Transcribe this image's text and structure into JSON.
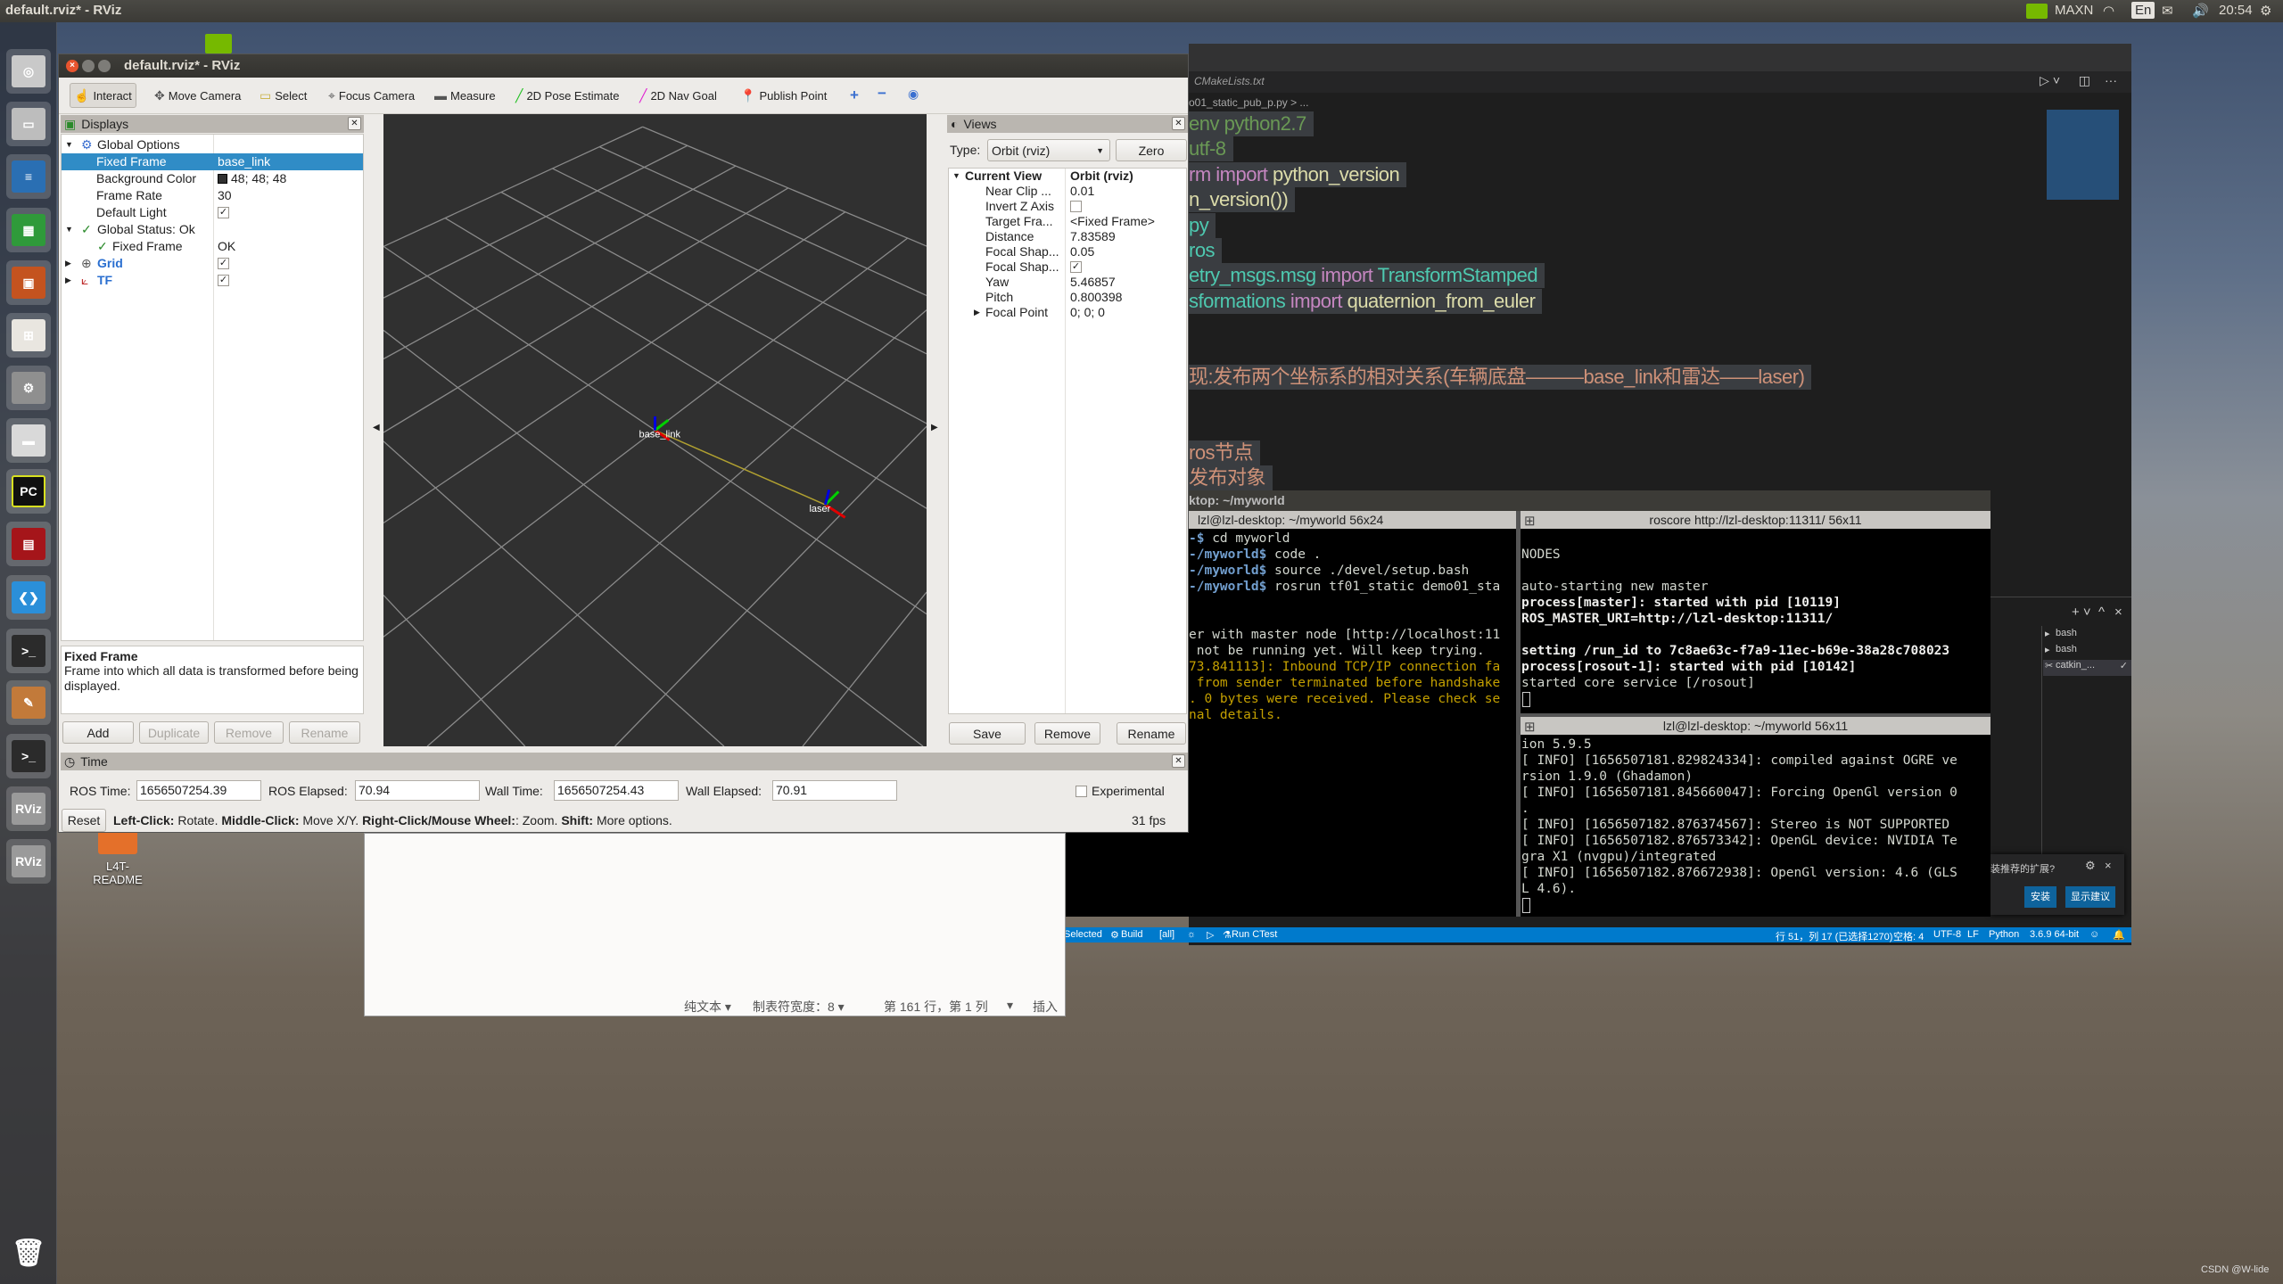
{
  "topbar": {
    "title": "default.rviz* - RViz",
    "power_mode": "MAXN",
    "input_method": "En",
    "clock": "20:54",
    "icons": [
      "nvidia-icon",
      "wifi-icon",
      "keyboard-icon",
      "mail-icon",
      "volume-icon",
      "settings-gear-icon"
    ]
  },
  "launcher": {
    "items": [
      {
        "name": "ubuntu-dash",
        "glyph": "◎",
        "color": "#c9c9c9"
      },
      {
        "name": "files",
        "glyph": "▭",
        "color": "#bdbdbd"
      },
      {
        "name": "libreoffice-writer",
        "glyph": "≡",
        "color": "#2a6fb3"
      },
      {
        "name": "libreoffice-calc",
        "glyph": "▦",
        "color": "#2f9a3a"
      },
      {
        "name": "libreoffice-impress",
        "glyph": "▣",
        "color": "#c4531f"
      },
      {
        "name": "software-center",
        "glyph": "⊞",
        "color": "#e9e6e0"
      },
      {
        "name": "system-settings",
        "glyph": "⚙",
        "color": "#8f8f8f"
      },
      {
        "name": "disks",
        "glyph": "▬",
        "color": "#d9d9d9"
      },
      {
        "name": "pycharm",
        "glyph": "PC",
        "color": "#101010"
      },
      {
        "name": "app-red",
        "glyph": "▤",
        "color": "#a5151a"
      },
      {
        "name": "vscode",
        "glyph": "❮❯",
        "color": "#2b8fd9"
      },
      {
        "name": "terminal",
        "glyph": ">_",
        "color": "#2b2b2b"
      },
      {
        "name": "text-editor",
        "glyph": "✎",
        "color": "#c27a3a"
      },
      {
        "name": "terminal",
        "glyph": ">_",
        "color": "#2b2b2b"
      },
      {
        "name": "rviz",
        "glyph": "RViz",
        "color": "#9a9a9a"
      },
      {
        "name": "rviz",
        "glyph": "RViz",
        "color": "#9a9a9a"
      }
    ],
    "trash": {
      "name": "trash",
      "glyph": "🗑"
    }
  },
  "desktop": {
    "icons": [
      {
        "label": "L4T-\nREADME"
      }
    ],
    "watermark": "CSDN @W-lide"
  },
  "rviz": {
    "title": "default.rviz* - RViz",
    "toolbar": [
      {
        "label": "Interact",
        "icon": "hand-icon",
        "active": true
      },
      {
        "label": "Move Camera",
        "icon": "move-camera-icon"
      },
      {
        "label": "Select",
        "icon": "select-icon"
      },
      {
        "label": "Focus Camera",
        "icon": "focus-camera-icon"
      },
      {
        "label": "Measure",
        "icon": "ruler-icon"
      },
      {
        "label": "2D Pose Estimate",
        "icon": "pose-arrow-icon",
        "color": "#22c022"
      },
      {
        "label": "2D Nav Goal",
        "icon": "nav-goal-arrow-icon",
        "color": "#e020d0"
      },
      {
        "label": "Publish Point",
        "icon": "map-pin-icon",
        "color": "#d03a20"
      }
    ],
    "displays": {
      "title": "Displays",
      "rows": [
        {
          "label": "Global Options",
          "value": ""
        },
        {
          "label": "Fixed Frame",
          "value": "base_link"
        },
        {
          "label": "Background Color",
          "value": "48; 48; 48",
          "swatch": "#303030"
        },
        {
          "label": "Frame Rate",
          "value": "30"
        },
        {
          "label": "Default Light",
          "checked": true
        },
        {
          "label": "Global Status: Ok",
          "value": ""
        },
        {
          "label": "Fixed Frame",
          "value": "OK"
        },
        {
          "label": "Grid",
          "checked": true
        },
        {
          "label": "TF",
          "checked": true
        }
      ],
      "description_title": "Fixed Frame",
      "description": "Frame into which all data is transformed before being displayed.",
      "buttons": {
        "add": "Add",
        "duplicate": "Duplicate",
        "remove": "Remove",
        "rename": "Rename"
      }
    },
    "viewport": {
      "background": "#303030",
      "frames": [
        {
          "name": "base_link"
        },
        {
          "name": "laser"
        }
      ]
    },
    "views": {
      "title": "Views",
      "type_label": "Type:",
      "type_value": "Orbit (rviz)",
      "zero": "Zero",
      "current_view": {
        "label": "Current View",
        "value": "Orbit (rviz)",
        "near_clip": "0.01",
        "invert_z": false,
        "target_frame": "<Fixed Frame>",
        "distance": "7.83589",
        "focal_shape_size": "0.05",
        "focal_shape_fixed": true,
        "yaw": "5.46857",
        "pitch": "0.800398",
        "focal_point": "0; 0; 0"
      },
      "prop_labels": [
        "Near Clip ...",
        "Invert Z Axis",
        "Target Fra...",
        "Distance",
        "Focal Shap...",
        "Focal Shap...",
        "Yaw",
        "Pitch",
        "Focal Point"
      ],
      "buttons": {
        "save": "Save",
        "remove": "Remove",
        "rename": "Rename"
      }
    },
    "time": {
      "title": "Time",
      "ros_time_label": "ROS Time:",
      "ros_time": "1656507254.39",
      "ros_elapsed_label": "ROS Elapsed:",
      "ros_elapsed": "70.94",
      "wall_time_label": "Wall Time:",
      "wall_time": "1656507254.43",
      "wall_elapsed_label": "Wall Elapsed:",
      "wall_elapsed": "70.91",
      "experimental": "Experimental"
    },
    "status": {
      "reset": "Reset",
      "help": [
        [
          "Left-Click:",
          " Rotate. "
        ],
        [
          "Middle-Click:",
          " Move X/Y. "
        ],
        [
          "Right-Click/Mouse Wheel:",
          ": Zoom. "
        ],
        [
          "Shift:",
          " More options."
        ]
      ],
      "fps": "31 fps"
    }
  },
  "vscode": {
    "tab": "CMakeLists.txt",
    "breadcrumb": "o01_static_pub_p.py > ...",
    "code": [
      [
        {
          "t": "env python2.7",
          "c": "#6a9955"
        }
      ],
      [
        {
          "t": "utf-8",
          "c": "#6a9955"
        }
      ],
      [
        {
          "t": "rm ",
          "c": "#c586c0"
        },
        {
          "t": "import ",
          "c": "#c586c0"
        },
        {
          "t": "python_version",
          "c": "#dcdcaa"
        }
      ],
      [
        {
          "t": "n_version())",
          "c": "#dcdcaa"
        }
      ],
      [
        {
          "t": "py",
          "c": "#4ec9b0"
        }
      ],
      [
        {
          "t": "ros",
          "c": "#4ec9b0"
        }
      ],
      [
        {
          "t": "etry_msgs.msg ",
          "c": "#4ec9b0"
        },
        {
          "t": "import ",
          "c": "#c586c0"
        },
        {
          "t": "TransformStamped",
          "c": "#4ec9b0"
        }
      ],
      [
        {
          "t": "sformations ",
          "c": "#4ec9b0"
        },
        {
          "t": "import ",
          "c": "#c586c0"
        },
        {
          "t": "quaternion_from_euler",
          "c": "#dcdcaa"
        }
      ],
      [],
      [],
      [
        {
          "t": "现:发布两个坐标系的相对关系(车辆底盘———base_link和雷达——laser)",
          "c": "#ce9178"
        }
      ],
      [],
      [],
      [
        {
          "t": "ros节点",
          "c": "#ce9178"
        }
      ],
      [
        {
          "t": "发布对象",
          "c": "#ce9178"
        }
      ]
    ],
    "terminal_list": [
      "bash",
      "bash",
      "catkin_..."
    ],
    "notification": {
      "text": "装推荐的扩展?",
      "install": "安装",
      "show": "显示建议"
    },
    "status": {
      "selected": "Selected",
      "build": "Build",
      "all": "[all]",
      "ctest": "Run CTest",
      "position": "行 51，列 17 (已选择1270)",
      "spaces": "空格: 4",
      "encoding": "UTF-8",
      "eol": "LF",
      "language": "Python",
      "interpreter": "3.6.9 64-bit"
    }
  },
  "terminal": {
    "title": "ktop: ~/myworld",
    "left": {
      "title": "lzl@lzl-desktop: ~/myworld 56x24",
      "lines": [
        {
          "p": "-$ ",
          "t": "cd myworld"
        },
        {
          "p": "-/myworld$ ",
          "t": "code ."
        },
        {
          "p": "-/myworld$ ",
          "t": "source ./devel/setup.bash"
        },
        {
          "p": "-/myworld$ ",
          "t": "rosrun tf01_static demo01_sta"
        },
        {
          "t": ""
        },
        {
          "t": ""
        },
        {
          "t": "er with master node [http://localhost:11"
        },
        {
          "t": " not be running yet. Will keep trying."
        },
        {
          "t": "73.841113]: Inbound TCP/IP connection fa",
          "w": true
        },
        {
          "t": " from sender terminated before handshake",
          "w": true
        },
        {
          "t": ". 0 bytes were received. Please check se",
          "w": true
        },
        {
          "t": "nal details.",
          "w": true
        }
      ]
    },
    "right_top": {
      "title": "roscore http://lzl-desktop:11311/ 56x11",
      "lines": [
        {
          "t": ""
        },
        {
          "t": "NODES"
        },
        {
          "t": ""
        },
        {
          "t": "auto-starting new master"
        },
        {
          "t": "process[master]: started with pid [10119]",
          "b": true
        },
        {
          "t": "ROS_MASTER_URI=http://lzl-desktop:11311/",
          "b": true
        },
        {
          "t": ""
        },
        {
          "t": "setting /run_id to 7c8ae63c-f7a9-11ec-b69e-38a28c708023",
          "b": true
        },
        {
          "t": "process[rosout-1]: started with pid [10142]",
          "b": true
        },
        {
          "t": "started core service [/rosout]"
        }
      ]
    },
    "right_bottom": {
      "title": "lzl@lzl-desktop: ~/myworld 56x11",
      "lines": [
        {
          "t": "ion 5.9.5"
        },
        {
          "t": "[ INFO] [1656507181.829824334]: compiled against OGRE ve"
        },
        {
          "t": "rsion 1.9.0 (Ghadamon)"
        },
        {
          "t": "[ INFO] [1656507181.845660047]: Forcing OpenGl version 0"
        },
        {
          "t": "."
        },
        {
          "t": "[ INFO] [1656507182.876374567]: Stereo is NOT SUPPORTED"
        },
        {
          "t": "[ INFO] [1656507182.876573342]: OpenGL device: NVIDIA Te"
        },
        {
          "t": "gra X1 (nvgpu)/integrated"
        },
        {
          "t": "[ INFO] [1656507182.876672938]: OpenGl version: 4.6 (GLS"
        },
        {
          "t": "L 4.6)."
        }
      ]
    }
  },
  "gedit": {
    "syntax": "纯文本 ▾",
    "tab_width": "制表符宽度：8 ▾",
    "position": "第 161 行，第 1 列",
    "pos_dropdown": "▾",
    "mode": "插入"
  }
}
